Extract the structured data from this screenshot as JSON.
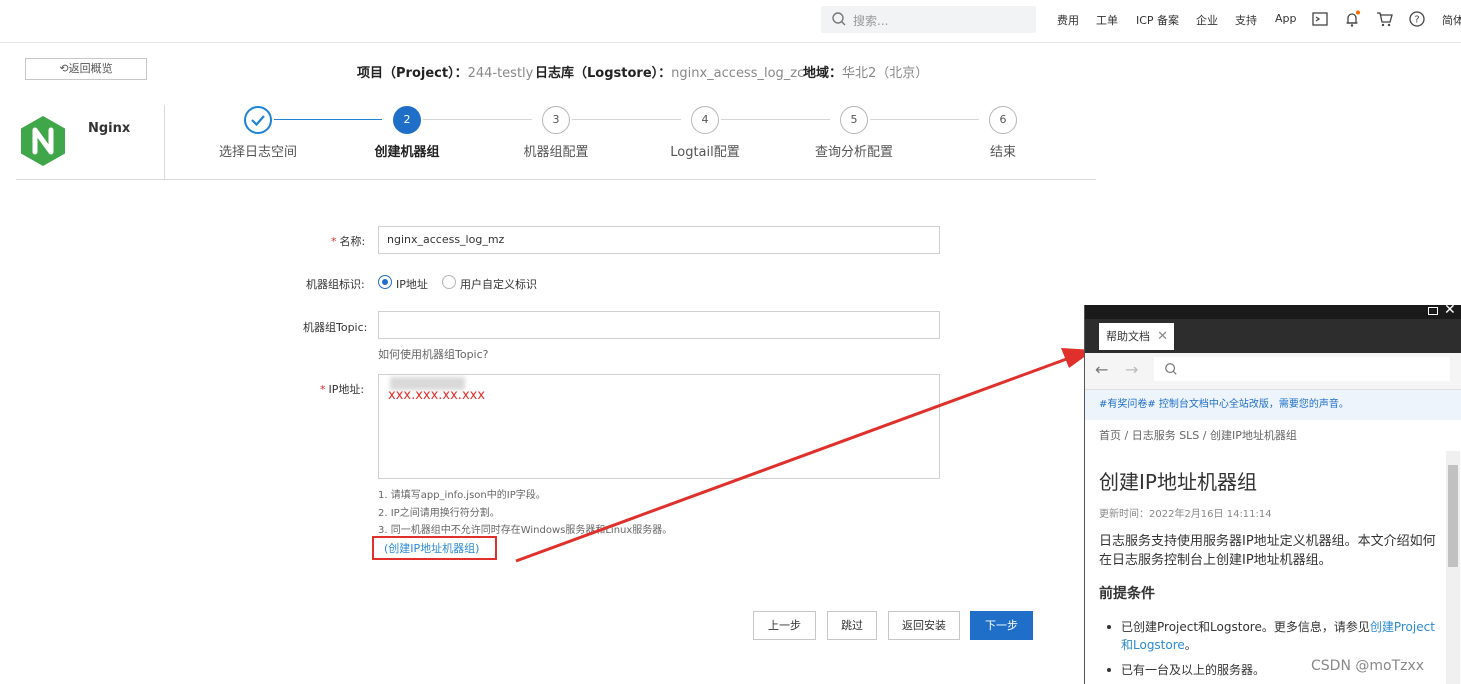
{
  "topbar": {
    "search_placeholder": "搜索...",
    "links": [
      "费用",
      "工单",
      "ICP 备案",
      "企业",
      "支持",
      "App"
    ],
    "lang": "简体",
    "icons": [
      "terminal-icon",
      "bell-icon",
      "cart-icon",
      "help-icon"
    ],
    "notification_dot_color": "#ff6a00"
  },
  "header": {
    "back_label": "返回概览",
    "project_label": "项目（Project）：",
    "project_value": "244-testly",
    "logstore_label": "日志库（Logstore）：",
    "logstore_value": "nginx_access_log_zc",
    "region_label": "地域：",
    "region_value": "华北2（北京）"
  },
  "app": {
    "name": "Nginx",
    "logo_color": "#3fa64a"
  },
  "steps": [
    {
      "num": "",
      "label": "选择日志空间",
      "state": "done"
    },
    {
      "num": "2",
      "label": "创建机器组",
      "state": "current"
    },
    {
      "num": "3",
      "label": "机器组配置",
      "state": "todo"
    },
    {
      "num": "4",
      "label": "Logtail配置",
      "state": "todo"
    },
    {
      "num": "5",
      "label": "查询分析配置",
      "state": "todo"
    },
    {
      "num": "6",
      "label": "结束",
      "state": "todo"
    }
  ],
  "form": {
    "name_label": "名称:",
    "name_value": "nginx_access_log_mz",
    "identifier_label": "机器组标识:",
    "identifier_options": [
      "IP地址",
      "用户自定义标识"
    ],
    "identifier_selected": "IP地址",
    "topic_label": "机器组Topic:",
    "topic_value": "",
    "topic_help": "如何使用机器组Topic?",
    "ip_label": "IP地址:",
    "ip_value": "xxx.xxx.xx.xxx",
    "hints": [
      "1. 请填写app_info.json中的IP字段。",
      "2. IP之间请用换行符分割。",
      "3. 同一机器组中不允许同时存在Windows服务器和Linux服务器。"
    ],
    "ip_group_link": "(创建IP地址机器组)"
  },
  "buttons": {
    "prev": "上一步",
    "skip": "跳过",
    "back_install": "返回安装",
    "next": "下一步"
  },
  "help_panel": {
    "tab_label": "帮助文档",
    "banner": "#有奖问卷# 控制台文档中心全站改版，需要您的声音。",
    "breadcrumb": "首页 / 日志服务 SLS / 创建IP地址机器组",
    "title": "创建IP地址机器组",
    "updated": "更新时间：2022年2月16日 14:11:14",
    "intro": "日志服务支持使用服务器IP地址定义机器组。本文介绍如何在日志服务控制台上创建IP地址机器组。",
    "section_title": "前提条件",
    "item1_text": "已创建Project和Logstore。更多信息，请参见",
    "item1_link": "创建Project和Logstore",
    "item1_end": "。",
    "item2_text": "已有一台及以上的服务器。"
  },
  "watermark": "CSDN @moTzxx",
  "colors": {
    "primary": "#1f6fc9",
    "link": "#2a8bd1",
    "highlight": "#e0302c"
  }
}
